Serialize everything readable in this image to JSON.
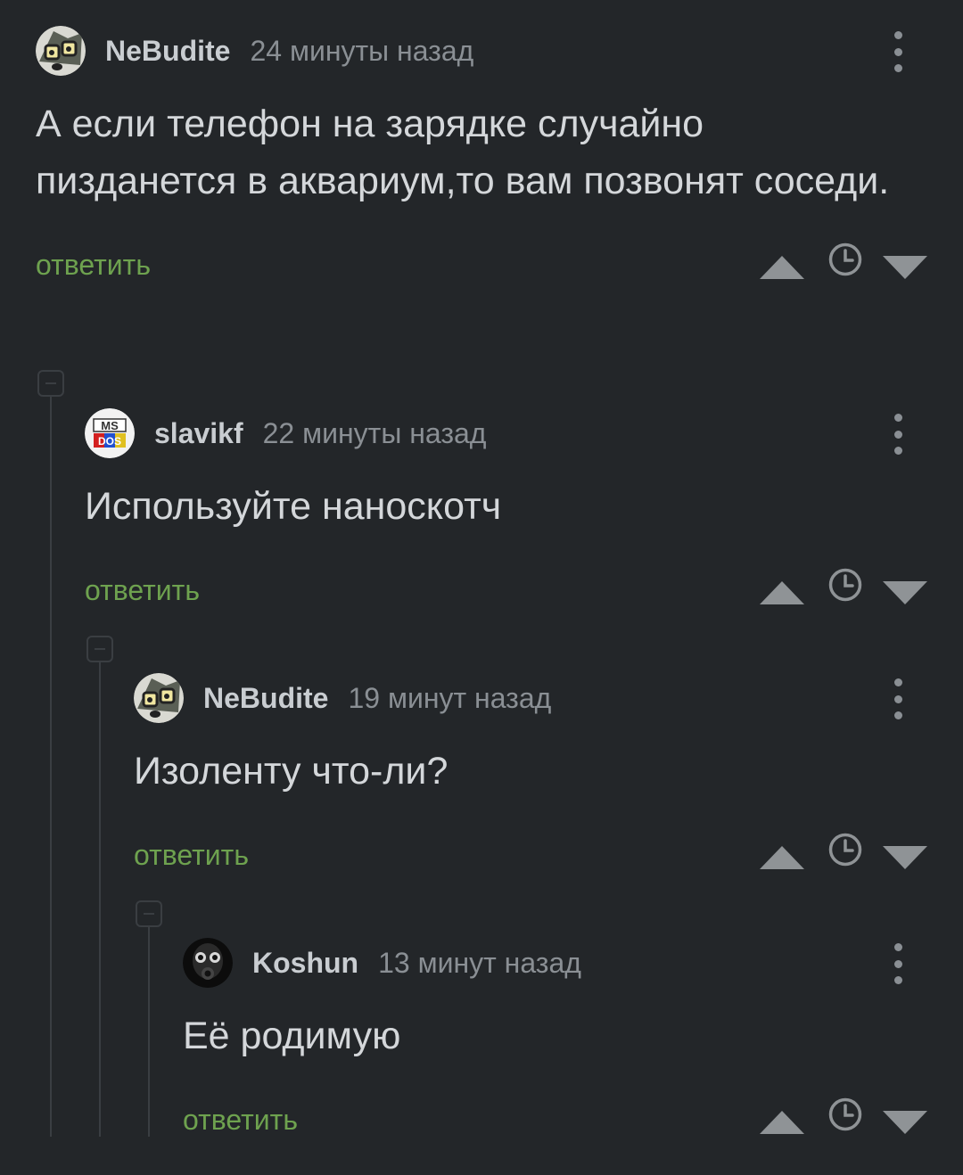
{
  "comments": [
    {
      "username": "NeBudite",
      "time": "24 минуты назад",
      "text": "А если телефон на зарядке случайно пизданется в аквариум,то вам позвонят соседи.",
      "reply_label": "ответить",
      "avatar_icon": "cartoon-face-avatar"
    },
    {
      "username": "slavikf",
      "time": "22 минуты назад",
      "text": "Используйте наноскотч",
      "reply_label": "ответить",
      "avatar_icon": "ms-dos-logo-avatar",
      "avatar_text": "MS DOS"
    },
    {
      "username": "NeBudite",
      "time": "19 минут назад",
      "text": "Изоленту что-ли?",
      "reply_label": "ответить",
      "avatar_icon": "cartoon-face-avatar"
    },
    {
      "username": "Koshun",
      "time": "13 минут назад",
      "text": "Её родимую",
      "reply_label": "ответить",
      "avatar_icon": "gas-mask-avatar"
    }
  ],
  "icons": {
    "menu": "more-vertical-icon",
    "upvote": "upvote-triangle-icon",
    "save": "clock-icon",
    "downvote": "downvote-triangle-icon",
    "collapse": "collapse-minus-icon"
  },
  "colors": {
    "background": "#232629",
    "reply_link": "#6ea24f",
    "thread_line": "#3a3e42",
    "username": "#c9cdd1",
    "meta": "#8a8f94"
  }
}
